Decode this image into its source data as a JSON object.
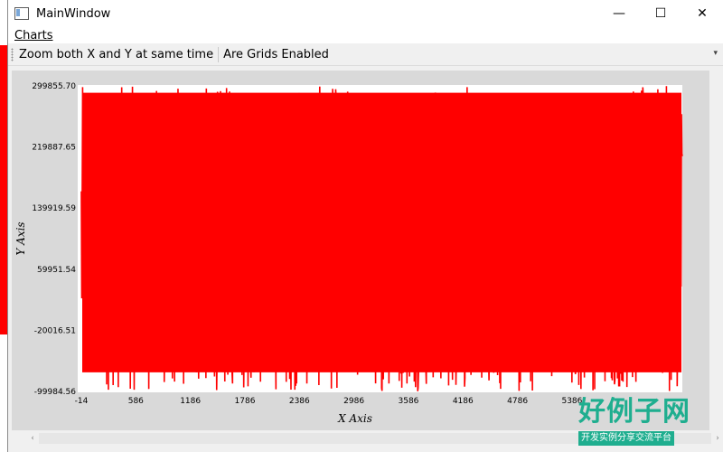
{
  "window": {
    "title": "MainWindow",
    "buttons": {
      "minimize": "—",
      "maximize": "☐",
      "close": "✕"
    }
  },
  "menubar": {
    "items": [
      {
        "label": "Charts"
      }
    ]
  },
  "toolbar": {
    "zoom_label": "Zoom both X and Y at same time",
    "grids_label": "Are Grids Enabled",
    "extension": "▾"
  },
  "scrollbar": {
    "left_arrow": "‹",
    "right_arrow": "›"
  },
  "watermark": {
    "title": "好例子网",
    "subtitle": "开发实例分享交流平台"
  },
  "colors": {
    "series": "#ff0000",
    "background": "#d9d9d9",
    "accent": "#1fae8f"
  },
  "chart_data": {
    "type": "line",
    "xlabel": "X Axis",
    "ylabel": "Y Axis",
    "xlim": [
      -14,
      6600
    ],
    "ylim": [
      -99984.56,
      299855.7
    ],
    "x_ticks": [
      "-14",
      "586",
      "1186",
      "1786",
      "2386",
      "2986",
      "3586",
      "4186",
      "4786",
      "5386"
    ],
    "y_ticks": [
      "299855.70",
      "219887.65",
      "139919.59",
      "59951.54",
      "-20016.51",
      "-99984.56"
    ],
    "grid": false,
    "legend": "none",
    "series": [
      {
        "color": "#ff0000",
        "points": 6600,
        "min": -99984.56,
        "max": 299855.7
      }
    ]
  }
}
